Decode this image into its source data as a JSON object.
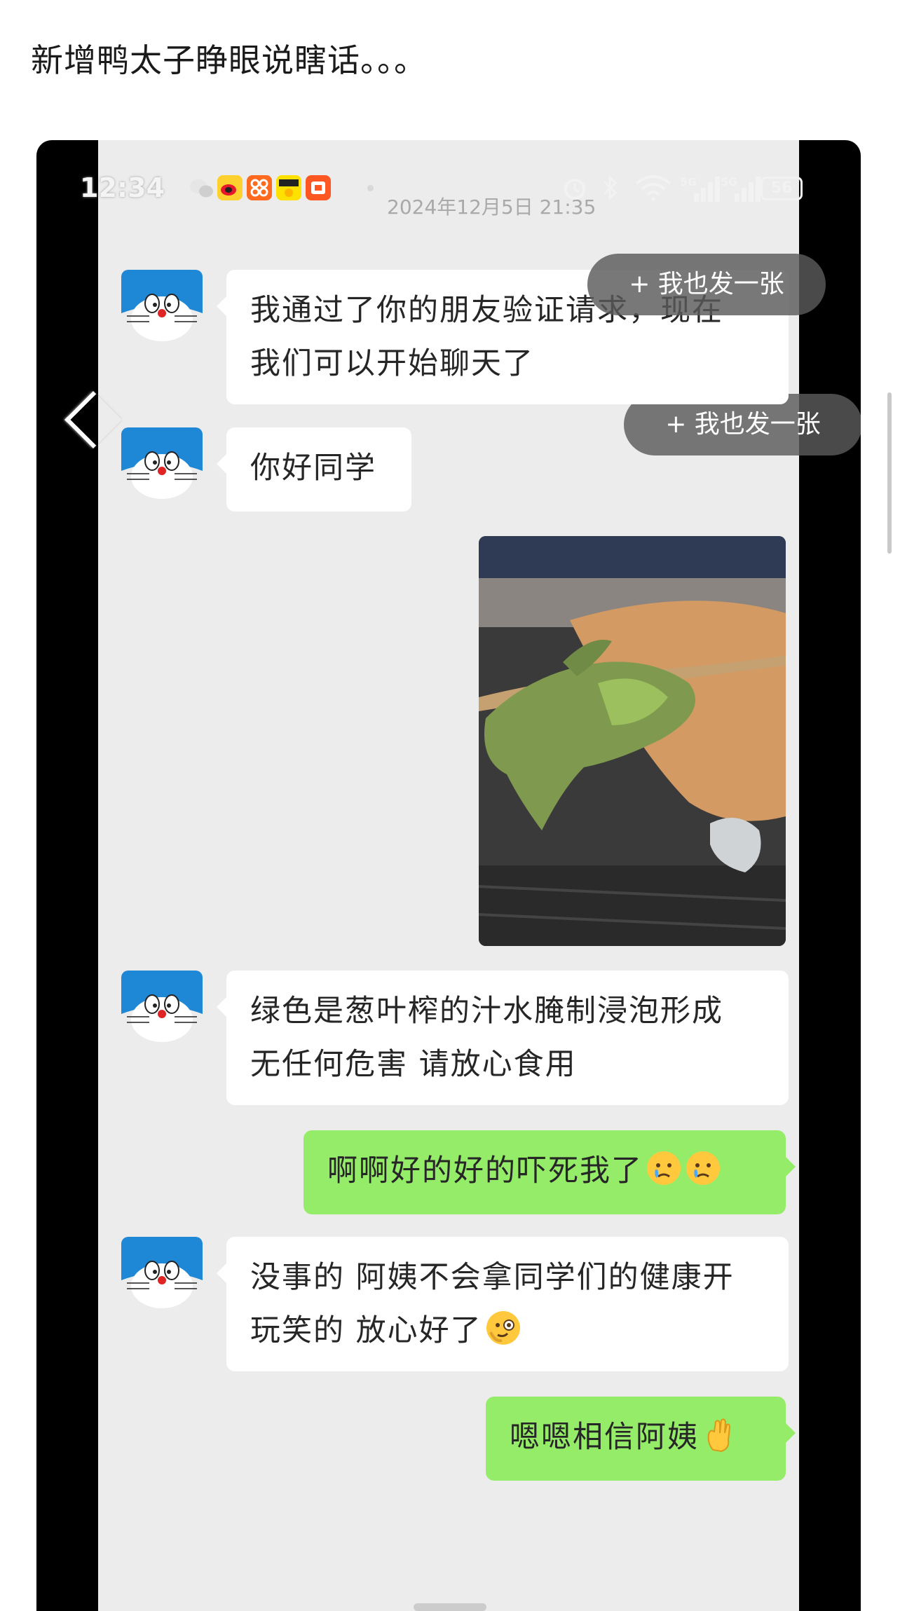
{
  "post": {
    "title": "新增鸭太子睁眼说瞎话。。。"
  },
  "status_bar": {
    "time": "12:34",
    "timestamp": "2024年12月5日 21:35",
    "network_1": "5G",
    "network_2": "5G",
    "battery": "56"
  },
  "share_button": {
    "label": "+ 我也发一张"
  },
  "messages": [
    {
      "side": "incoming",
      "lines": [
        "我通过了你的朋友验证请求，现在",
        "我们可以开始聊天了"
      ]
    },
    {
      "side": "incoming",
      "lines": [
        "你好同学"
      ]
    },
    {
      "side": "outgoing",
      "kind": "image"
    },
    {
      "side": "incoming",
      "lines": [
        "绿色是葱叶榨的汁水腌制浸泡形成",
        "无任何危害 请放心食用"
      ]
    },
    {
      "side": "outgoing",
      "lines": [
        "啊啊好的好的吓死我了"
      ],
      "emoji": [
        "crying-face",
        "crying-face"
      ]
    },
    {
      "side": "incoming",
      "lines": [
        "没事的 阿姨不会拿同学们的健康开",
        "玩笑的 放心好了"
      ],
      "emoji": [
        "monocle-face"
      ]
    },
    {
      "side": "outgoing",
      "lines": [
        "嗯嗯相信阿姨"
      ],
      "emoji": [
        "ok-hand"
      ]
    }
  ],
  "colors": {
    "chat_background": "#ececec",
    "incoming_bubble": "#ffffff",
    "outgoing_bubble": "#95ec69",
    "frame": "#000000"
  },
  "icons": [
    "wechat-icon",
    "weibo-icon",
    "app-icon-orange",
    "xianyu-icon",
    "app-icon-red",
    "alarm-icon",
    "bluetooth-icon",
    "wifi-icon",
    "back-icon",
    "doraemon-avatar"
  ]
}
